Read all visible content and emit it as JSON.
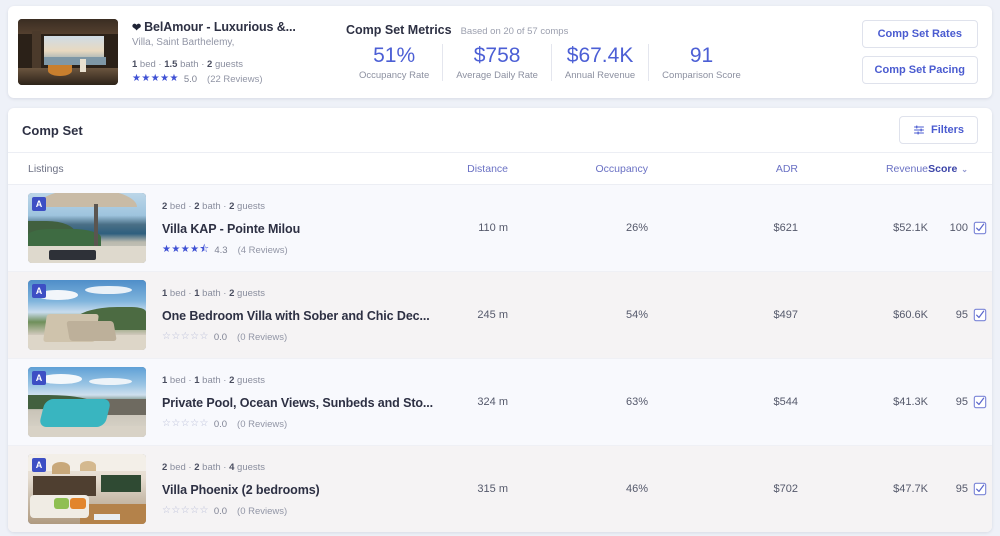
{
  "header": {
    "listing": {
      "heart_icon": "heart-icon",
      "title": "BelAmour - Luxurious &...",
      "subtitle": "Villa, Saint Barthelemy,",
      "beds": "1",
      "beds_label": " bed · ",
      "baths": "1.5",
      "baths_label": " bath · ",
      "guests": "2",
      "guests_label": " guests",
      "stars": "★★★★★",
      "rating": "5.0",
      "reviews": "(22 Reviews)"
    },
    "metrics": {
      "title": "Comp Set Metrics",
      "basis": "Based on 20 of 57 comps",
      "items": [
        {
          "value": "51%",
          "label": "Occupancy Rate"
        },
        {
          "value": "$758",
          "label": "Average Daily Rate"
        },
        {
          "value": "$67.4K",
          "label": "Annual Revenue"
        },
        {
          "value": "91",
          "label": "Comparison Score"
        }
      ]
    },
    "buttons": {
      "comp_set_rates": "Comp Set Rates",
      "comp_set_pacing": "Comp Set Pacing"
    }
  },
  "panel": {
    "title": "Comp Set",
    "filters_label": "Filters",
    "filters_icon": "filter-sliders-icon",
    "columns": {
      "listings": "Listings",
      "distance": "Distance",
      "occupancy": "Occupancy",
      "adr": "ADR",
      "revenue": "Revenue",
      "score": "Score",
      "sort_caret": "⌄"
    },
    "rows": [
      {
        "badge": "A",
        "beds": "2",
        "beds_label": " bed · ",
        "baths": "2",
        "baths_label": " bath · ",
        "guests": "2",
        "guests_label": " guests",
        "name": "Villa KAP - Pointe Milou",
        "stars": "★★★★⯪",
        "rating": "4.3",
        "reviews": "(4 Reviews)",
        "distance": "110 m",
        "occupancy": "26%",
        "adr": "$621",
        "revenue": "$52.1K",
        "score": "100",
        "checkbox": "checked"
      },
      {
        "badge": "A",
        "beds": "1",
        "beds_label": " bed · ",
        "baths": "1",
        "baths_label": " bath · ",
        "guests": "2",
        "guests_label": " guests",
        "name": "One Bedroom Villa with Sober and Chic Dec...",
        "stars": "☆☆☆☆☆",
        "rating": "0.0",
        "reviews": "(0 Reviews)",
        "distance": "245 m",
        "occupancy": "54%",
        "adr": "$497",
        "revenue": "$60.6K",
        "score": "95",
        "checkbox": "checked"
      },
      {
        "badge": "A",
        "beds": "1",
        "beds_label": " bed · ",
        "baths": "1",
        "baths_label": " bath · ",
        "guests": "2",
        "guests_label": " guests",
        "name": "Private Pool, Ocean Views, Sunbeds and Sto...",
        "stars": "☆☆☆☆☆",
        "rating": "0.0",
        "reviews": "(0 Reviews)",
        "distance": "324 m",
        "occupancy": "63%",
        "adr": "$544",
        "revenue": "$41.3K",
        "score": "95",
        "checkbox": "checked"
      },
      {
        "badge": "A",
        "beds": "2",
        "beds_label": " bed · ",
        "baths": "2",
        "baths_label": " bath · ",
        "guests": "4",
        "guests_label": " guests",
        "name": "Villa Phoenix (2 bedrooms)",
        "stars": "☆☆☆☆☆",
        "rating": "0.0",
        "reviews": "(0 Reviews)",
        "distance": "315 m",
        "occupancy": "46%",
        "adr": "$702",
        "revenue": "$47.7K",
        "score": "95",
        "checkbox": "checked"
      }
    ]
  },
  "colors": {
    "accent": "#4c5fd5",
    "link": "#6a71c4",
    "page_bg": "#eef1f8",
    "row_a": "#f8f9fd",
    "row_b": "#f5f3f4"
  }
}
